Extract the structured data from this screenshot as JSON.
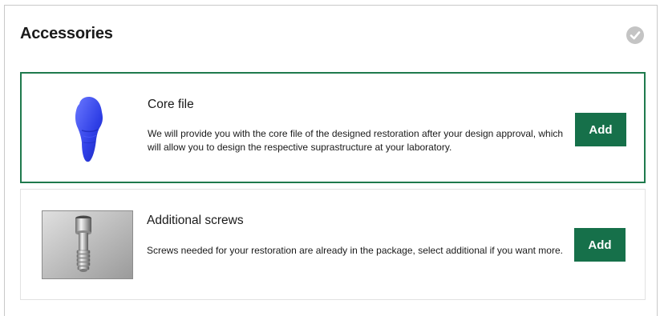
{
  "section": {
    "title": "Accessories"
  },
  "status": {
    "icon": "check-circle-icon",
    "color": "#c4c4c4"
  },
  "accent_color": "#16704a",
  "items": [
    {
      "title": "Core file",
      "description": "We will provide you with the core file of the designed restoration after your design approval, which will allow you to design the respective suprastructure at your laboratory.",
      "button_label": "Add",
      "image": "blue-abutment-core-image",
      "selected": true
    },
    {
      "title": "Additional screws",
      "description": "Screws needed for your restoration are already in the package, select additional if you want more.",
      "button_label": "Add",
      "image": "implant-screw-photo",
      "selected": false
    }
  ]
}
